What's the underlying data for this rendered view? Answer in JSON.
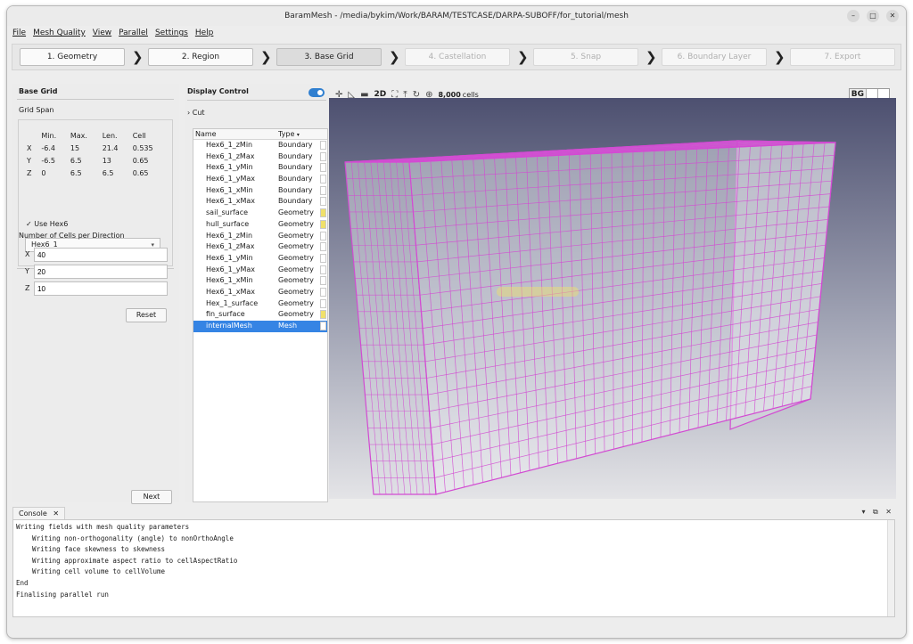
{
  "window": {
    "title": "BaramMesh - /media/bykim/Work/BARAM/TESTCASE/DARPA-SUBOFF/for_tutorial/mesh"
  },
  "menu": [
    "File",
    "Mesh Quality",
    "View",
    "Parallel",
    "Settings",
    "Help"
  ],
  "steps": [
    "1. Geometry",
    "2. Region",
    "3. Base Grid",
    "4. Castellation",
    "5. Snap",
    "6. Boundary Layer",
    "7. Export"
  ],
  "base_grid": {
    "title": "Base Grid",
    "grid_span_label": "Grid Span",
    "columns": [
      "Min.",
      "Max.",
      "Len.",
      "Cell"
    ],
    "rows": [
      {
        "axis": "X",
        "min": "-6.4",
        "max": "15",
        "len": "21.4",
        "cell": "0.535"
      },
      {
        "axis": "Y",
        "min": "-6.5",
        "max": "6.5",
        "len": "13",
        "cell": "0.65"
      },
      {
        "axis": "Z",
        "min": "0",
        "max": "6.5",
        "len": "6.5",
        "cell": "0.65"
      }
    ],
    "use_hex6_label": "Use Hex6",
    "hex6_selected": "Hex6_1",
    "cells_label": "Number of Cells per Direction",
    "x_label": "X",
    "x_value": "40",
    "y_label": "Y",
    "y_value": "20",
    "z_label": "Z",
    "z_value": "10",
    "reset_label": "Reset",
    "next_label": "Next"
  },
  "display_control": {
    "title": "Display Control",
    "cut_label": "Cut",
    "col_name": "Name",
    "col_type": "Type",
    "rows": [
      {
        "name": "Hex6_1_zMin",
        "type": "Boundary",
        "color": "#ffffff"
      },
      {
        "name": "Hex6_1_zMax",
        "type": "Boundary",
        "color": "#ffffff"
      },
      {
        "name": "Hex6_1_yMin",
        "type": "Boundary",
        "color": "#ffffff"
      },
      {
        "name": "Hex6_1_yMax",
        "type": "Boundary",
        "color": "#ffffff"
      },
      {
        "name": "Hex6_1_xMin",
        "type": "Boundary",
        "color": "#ffffff"
      },
      {
        "name": "Hex6_1_xMax",
        "type": "Boundary",
        "color": "#ffffff"
      },
      {
        "name": "sail_surface",
        "type": "Geometry",
        "color": "#f0e06a"
      },
      {
        "name": "hull_surface",
        "type": "Geometry",
        "color": "#f0e06a"
      },
      {
        "name": "Hex6_1_zMin",
        "type": "Geometry",
        "color": "#ffffff"
      },
      {
        "name": "Hex6_1_zMax",
        "type": "Geometry",
        "color": "#ffffff"
      },
      {
        "name": "Hex6_1_yMin",
        "type": "Geometry",
        "color": "#ffffff"
      },
      {
        "name": "Hex6_1_yMax",
        "type": "Geometry",
        "color": "#ffffff"
      },
      {
        "name": "Hex6_1_xMin",
        "type": "Geometry",
        "color": "#ffffff"
      },
      {
        "name": "Hex6_1_xMax",
        "type": "Geometry",
        "color": "#ffffff"
      },
      {
        "name": "Hex_1_surface",
        "type": "Geometry",
        "color": "#ffffff"
      },
      {
        "name": "fin_surface",
        "type": "Geometry",
        "color": "#f0e06a"
      },
      {
        "name": "internalMesh",
        "type": "Mesh",
        "color": "#ffffff",
        "selected": true
      }
    ]
  },
  "view_toolbar": {
    "mode_2d": "2D",
    "cells_count": "8,000",
    "cells_unit": "cells",
    "bg_label": "BG"
  },
  "console": {
    "tab_label": "Console",
    "lines": [
      "Writing fields with mesh quality parameters",
      "    Writing non-orthogonality (angle) to nonOrthoAngle",
      "    Writing face skewness to skewness",
      "    Writing approximate aspect ratio to cellAspectRatio",
      "    Writing cell volume to cellVolume",
      "End",
      "Finalising parallel run"
    ]
  },
  "colors": {
    "accent": "#3584e4",
    "mesh": "#d24bd2",
    "geometry": "#f0e06a"
  }
}
